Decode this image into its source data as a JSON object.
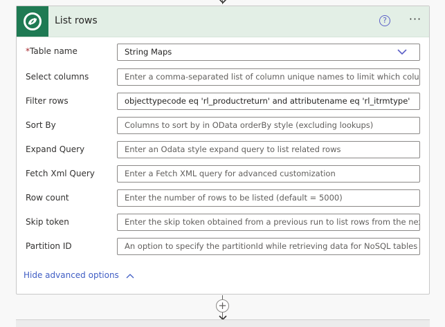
{
  "card": {
    "title": "List rows",
    "help_icon": "?",
    "more_icon": "···",
    "brand_color": "#1e7a53",
    "header_color": "#e3efe6"
  },
  "fields": [
    {
      "label": "Table name",
      "required": "*",
      "value": "String Maps",
      "placeholder": ""
    },
    {
      "label": "Select columns",
      "value": "",
      "placeholder": "Enter a comma-separated list of column unique names to limit which columns a"
    },
    {
      "label": "Filter rows",
      "value": "objecttypecode eq 'rl_productreturn' and attributename eq 'rl_itrmtype'",
      "placeholder": ""
    },
    {
      "label": "Sort By",
      "value": "",
      "placeholder": "Columns to sort by in OData orderBy style (excluding lookups)"
    },
    {
      "label": "Expand Query",
      "value": "",
      "placeholder": "Enter an Odata style expand query to list related rows"
    },
    {
      "label": "Fetch Xml Query",
      "value": "",
      "placeholder": "Enter a Fetch XML query for advanced customization"
    },
    {
      "label": "Row count",
      "value": "",
      "placeholder": "Enter the number of rows to be listed (default = 5000)"
    },
    {
      "label": "Skip token",
      "value": "",
      "placeholder": "Enter the skip token obtained from a previous run to list rows from the next pag"
    },
    {
      "label": "Partition ID",
      "value": "",
      "placeholder": "An option to specify the partitionId while retrieving data for NoSQL tables"
    }
  ],
  "advanced": {
    "hide_label": "Hide advanced options"
  },
  "flow": {
    "add_step": "+"
  }
}
